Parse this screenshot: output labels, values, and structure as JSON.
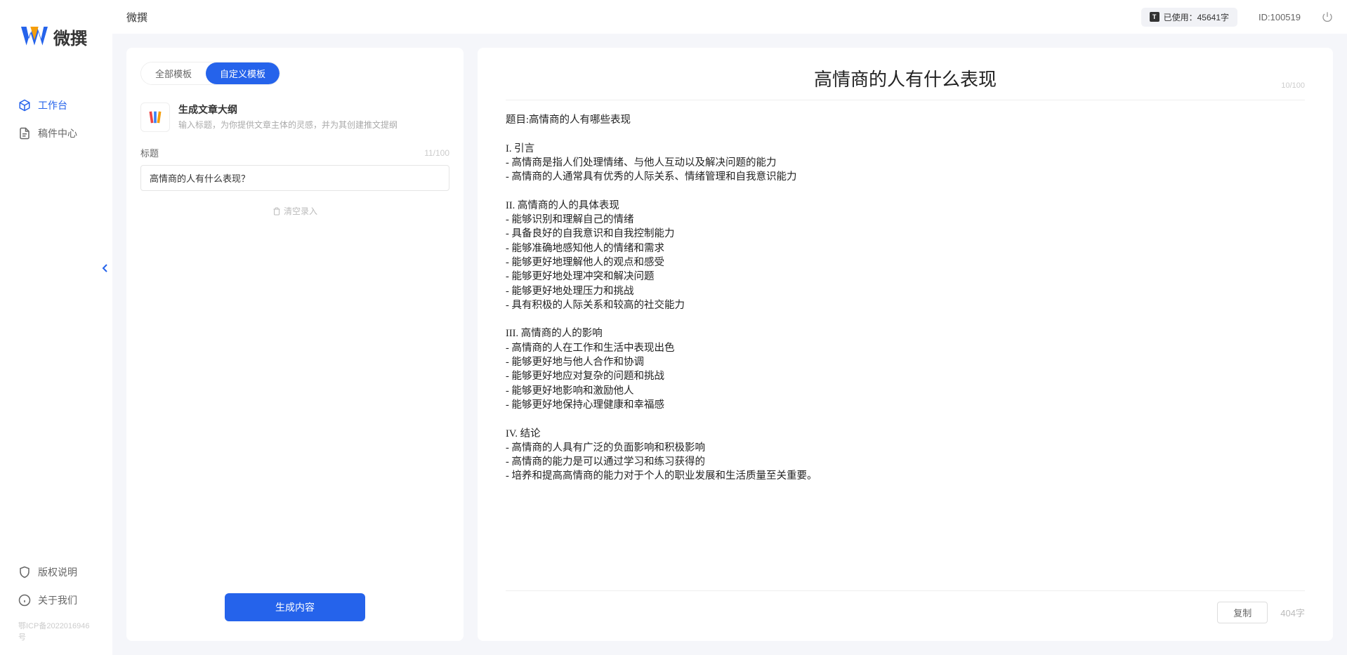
{
  "app": {
    "name": "微撰",
    "topbar_title": "微撰",
    "usage_label": "已使用：45641字",
    "user_id": "ID:100519",
    "footer": "鄂ICP备2022016946号"
  },
  "sidebar": {
    "items": [
      {
        "label": "工作台"
      },
      {
        "label": "稿件中心"
      }
    ],
    "bottom": [
      {
        "label": "版权说明"
      },
      {
        "label": "关于我们"
      }
    ]
  },
  "left_panel": {
    "tabs": [
      {
        "label": "全部模板"
      },
      {
        "label": "自定义模板"
      }
    ],
    "template": {
      "title": "生成文章大纲",
      "desc": "输入标题，为你提供文章主体的灵感，并为其创建推文提纲"
    },
    "title_field": {
      "label": "标题",
      "counter": "11/100",
      "value": "高情商的人有什么表现？"
    },
    "clear_label": "清空录入",
    "generate_label": "生成内容"
  },
  "right_panel": {
    "title": "高情商的人有什么表现",
    "title_counter": "10/100",
    "content": "题目:高情商的人有哪些表现\n\nI. 引言\n- 高情商是指人们处理情绪、与他人互动以及解决问题的能力\n- 高情商的人通常具有优秀的人际关系、情绪管理和自我意识能力\n\nII. 高情商的人的具体表现\n- 能够识别和理解自己的情绪\n- 具备良好的自我意识和自我控制能力\n- 能够准确地感知他人的情绪和需求\n- 能够更好地理解他人的观点和感受\n- 能够更好地处理冲突和解决问题\n- 能够更好地处理压力和挑战\n- 具有积极的人际关系和较高的社交能力\n\nIII. 高情商的人的影响\n- 高情商的人在工作和生活中表现出色\n- 能够更好地与他人合作和协调\n- 能够更好地应对复杂的问题和挑战\n- 能够更好地影响和激励他人\n- 能够更好地保持心理健康和幸福感\n\nIV. 结论\n- 高情商的人具有广泛的负面影响和积极影响\n- 高情商的能力是可以通过学习和练习获得的\n- 培养和提高高情商的能力对于个人的职业发展和生活质量至关重要。",
    "copy_label": "复制",
    "char_count": "404字"
  }
}
